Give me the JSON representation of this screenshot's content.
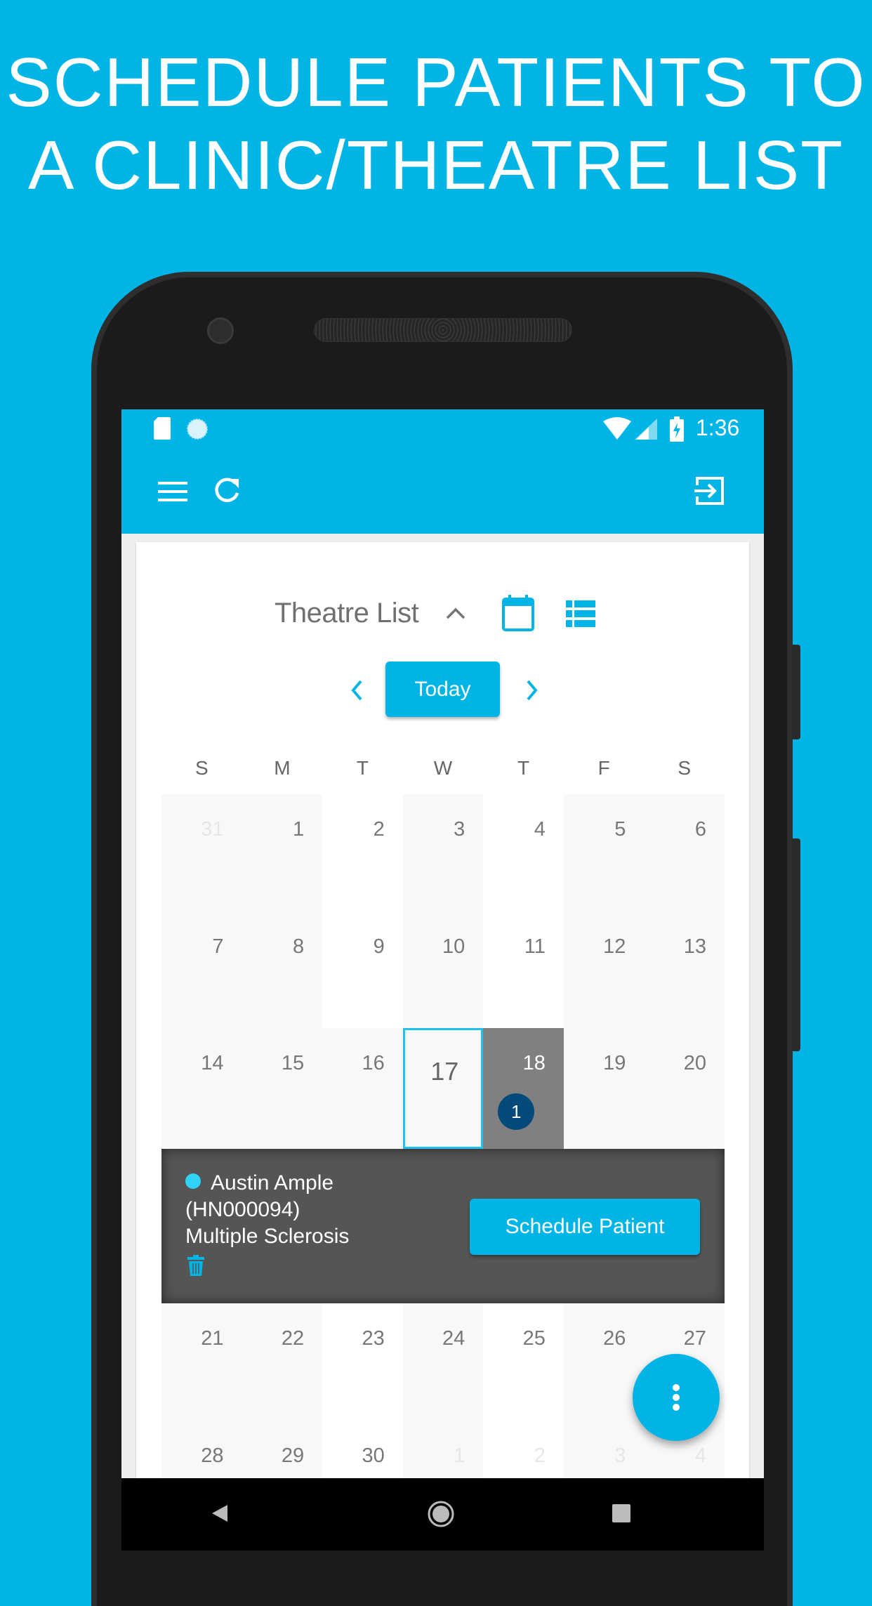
{
  "headline": {
    "line1": "SCHEDULE PATIENTS TO",
    "line2": "A CLINIC/THEATRE LIST"
  },
  "status_bar": {
    "time": "1:36",
    "icons": [
      "sd-card-icon",
      "sync-icon",
      "wifi-icon",
      "signal-icon",
      "battery-charging-icon"
    ]
  },
  "app_bar": {
    "icons": [
      "menu-icon",
      "refresh-icon",
      "logout-icon"
    ]
  },
  "header": {
    "title": "Theatre List",
    "today_label": "Today",
    "icons": [
      "chevron-up-icon",
      "calendar-icon",
      "list-view-icon",
      "chevron-left-icon",
      "chevron-right-icon"
    ]
  },
  "calendar": {
    "weekdays": [
      "S",
      "M",
      "T",
      "W",
      "T",
      "F",
      "S"
    ],
    "weeks": [
      [
        {
          "day": "31",
          "muted": true
        },
        {
          "day": "1"
        },
        {
          "day": "2"
        },
        {
          "day": "3"
        },
        {
          "day": "4"
        },
        {
          "day": "5"
        },
        {
          "day": "6"
        }
      ],
      [
        {
          "day": "7"
        },
        {
          "day": "8"
        },
        {
          "day": "9"
        },
        {
          "day": "10"
        },
        {
          "day": "11"
        },
        {
          "day": "12"
        },
        {
          "day": "13"
        }
      ],
      [
        {
          "day": "14"
        },
        {
          "day": "15"
        },
        {
          "day": "16"
        },
        {
          "day": "17",
          "selected": true
        },
        {
          "day": "18",
          "highlighted": true,
          "badge": "1"
        },
        {
          "day": "19"
        },
        {
          "day": "20"
        }
      ],
      [
        {
          "day": "21"
        },
        {
          "day": "22"
        },
        {
          "day": "23"
        },
        {
          "day": "24"
        },
        {
          "day": "25"
        },
        {
          "day": "26"
        },
        {
          "day": "27"
        }
      ],
      [
        {
          "day": "28"
        },
        {
          "day": "29"
        },
        {
          "day": "30"
        },
        {
          "day": "1",
          "muted": true
        },
        {
          "day": "2",
          "muted": true
        },
        {
          "day": "3",
          "muted": true
        },
        {
          "day": "4",
          "muted": true
        }
      ]
    ]
  },
  "detail": {
    "patient_name": "Austin Ample",
    "patient_id": "(HN000094)",
    "condition": "Multiple Sclerosis",
    "schedule_label": "Schedule Patient",
    "dot_color": "#2ed3f5"
  },
  "colors": {
    "brand": "#00b5e5",
    "selected_border": "#1ec0ec",
    "badge": "#024a7a",
    "panel": "#555555"
  }
}
